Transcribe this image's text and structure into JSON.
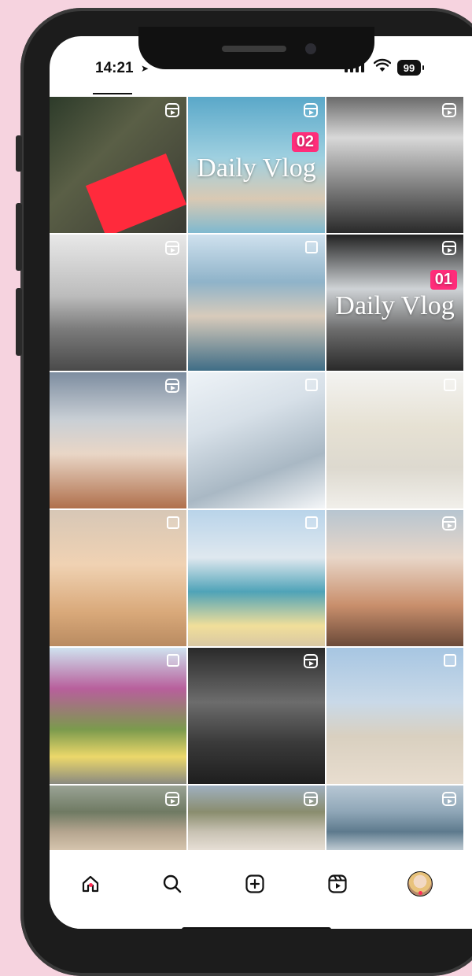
{
  "status_bar": {
    "time": "14:21",
    "battery": "99"
  },
  "grid": [
    {
      "kind": "reel",
      "bg": "linear-gradient(135deg,#2d3b2a 0%,#5a5f46 40%,#3a3a33 100%)",
      "accent": "#ff2a3c"
    },
    {
      "kind": "reel",
      "bg": "linear-gradient(180deg,#5aa8c9 0%,#9fd0e0 45%,#d9c9b3 75%,#7fb9cf 100%)",
      "overlay_badge": "02",
      "overlay_title": "Daily Vlog"
    },
    {
      "kind": "reel",
      "bg": "linear-gradient(180deg,#6a6a6a 0%,#d8d8d8 30%,#2a2a2a 100%)"
    },
    {
      "kind": "reel",
      "bg": "linear-gradient(180deg,#e8e8e8 0%,#bcbcbc 45%,#7a7a7a 70%,#4a4a4a 100%)"
    },
    {
      "kind": "multi",
      "bg": "linear-gradient(180deg,#cfe1ee 0%,#8fb3c9 35%,#d8cbbb 60%,#3f6d86 100%)"
    },
    {
      "kind": "reel",
      "bg": "linear-gradient(180deg,#222 0%,#cfd3d6 40%,#6c6c6c 70%,#2a2a2a 100%)",
      "overlay_badge": "01",
      "overlay_title": "Daily Vlog"
    },
    {
      "kind": "reel",
      "bg": "linear-gradient(180deg,#7d8da0 0%,#c9cfd5 35%,#e9d6c6 60%,#b0704c 100%)"
    },
    {
      "kind": "multi",
      "bg": "linear-gradient(160deg,#eef3f7 0%,#d7e0e8 35%,#a9b8c4 70%,#f4f6f8 100%)"
    },
    {
      "kind": "multi",
      "bg": "linear-gradient(180deg,#f3f3f1 0%,#e6e1d3 40%,#ddd9cf 70%,#f1efea 100%)"
    },
    {
      "kind": "multi",
      "bg": "linear-gradient(180deg,#d7c7b6 0%,#f0d2b3 40%,#d9a97a 75%,#b98b61 100%)"
    },
    {
      "kind": "multi",
      "bg": "linear-gradient(180deg,#b9d4ea 0%,#dfe8ef 35%,#4fa3b8 60%,#f1df9a 85%,#d9c8a3 100%)"
    },
    {
      "kind": "reel",
      "bg": "linear-gradient(180deg,#b7c5d0 0%,#e8d6c8 35%,#c98f6c 70%,#6b4a39 100%)"
    },
    {
      "kind": "multi",
      "bg": "linear-gradient(180deg,#cfe2ef 0%,#b85f9c 30%,#7b9a4d 60%,#ecd86a 80%,#8a8a80 100%)"
    },
    {
      "kind": "reel",
      "bg": "linear-gradient(180deg,#2a2a2a 0%,#6c6c6c 40%,#3a3a3a 70%,#1e1e1e 100%)"
    },
    {
      "kind": "multi",
      "bg": "linear-gradient(180deg,#a7c6e2 0%,#c9d9e8 40%,#d9d0c0 65%,#e8ddcf 100%)"
    },
    {
      "kind": "reel",
      "bg": "linear-gradient(180deg,#9aa395 0%,#6f7a63 40%,#b5a58f 70%,#d8c7b0 100%)"
    },
    {
      "kind": "reel",
      "bg": "linear-gradient(180deg,#9fb0c0 0%,#8a8d6e 40%,#c8c2b3 70%,#e9e1d8 100%)"
    },
    {
      "kind": "reel",
      "bg": "linear-gradient(180deg,#b7c7d4 0%,#8fa6b7 40%,#5d7a8d 70%,#c7d1d8 100%)"
    }
  ],
  "nav": {
    "items": [
      "home-icon",
      "search-icon",
      "create-icon",
      "reels-icon",
      "profile-avatar"
    ],
    "active_color": "#ff2d55"
  }
}
